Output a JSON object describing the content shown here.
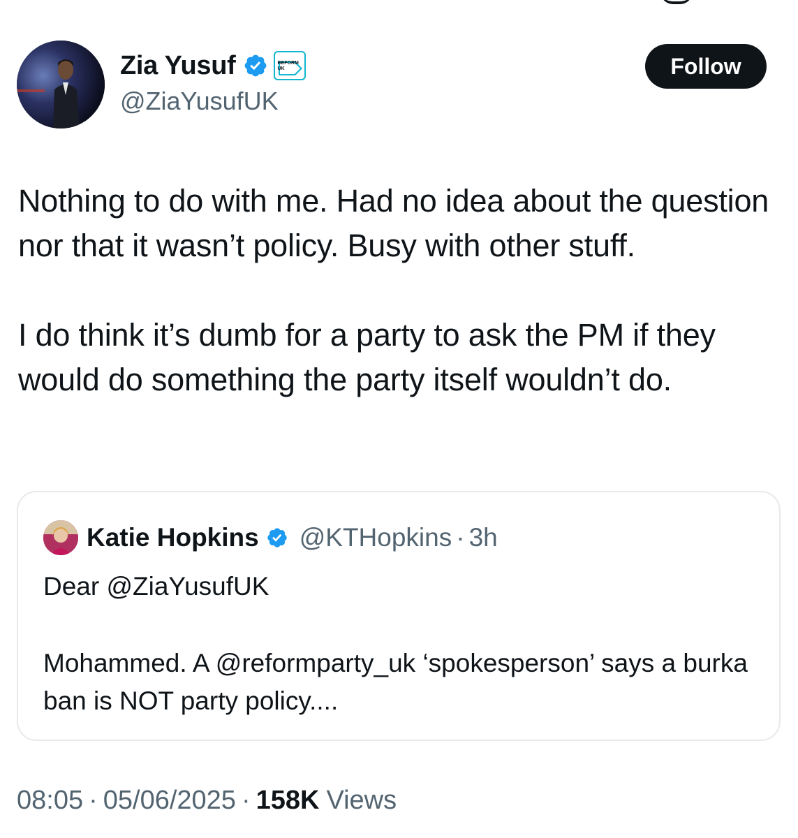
{
  "author": {
    "display_name": "Zia Yusuf",
    "handle": "@ZiaYusufUK",
    "verified_icon": "verified-check-icon",
    "affiliate_icon": "reform-uk-affiliate-icon",
    "affiliate_text": "REFORM UK"
  },
  "follow_button": {
    "label": "Follow"
  },
  "tweet": {
    "paragraphs": [
      "Nothing to do with me. Had no idea about the question nor that it wasn’t policy. Busy with other stuff.",
      "I do think it’s dumb for a party to ask the PM if they would do something the party itself wouldn’t do."
    ]
  },
  "quoted_tweet": {
    "display_name": "Katie Hopkins",
    "handle": "@KTHopkins",
    "separator": "·",
    "time": "3h",
    "paragraphs": [
      "Dear @ZiaYusufUK",
      "Mohammed. A @reformparty_uk ‘spokesperson’ says a burka ban is NOT party policy...."
    ]
  },
  "meta": {
    "time": "08:05",
    "separator": "·",
    "date": "05/06/2025",
    "views_count": "158K",
    "views_label": "Views"
  },
  "colors": {
    "text": "#0f1419",
    "secondary": "#536471",
    "verified": "#1d9bf0",
    "affiliate": "#12b6cf",
    "border": "#e7e9ea"
  }
}
